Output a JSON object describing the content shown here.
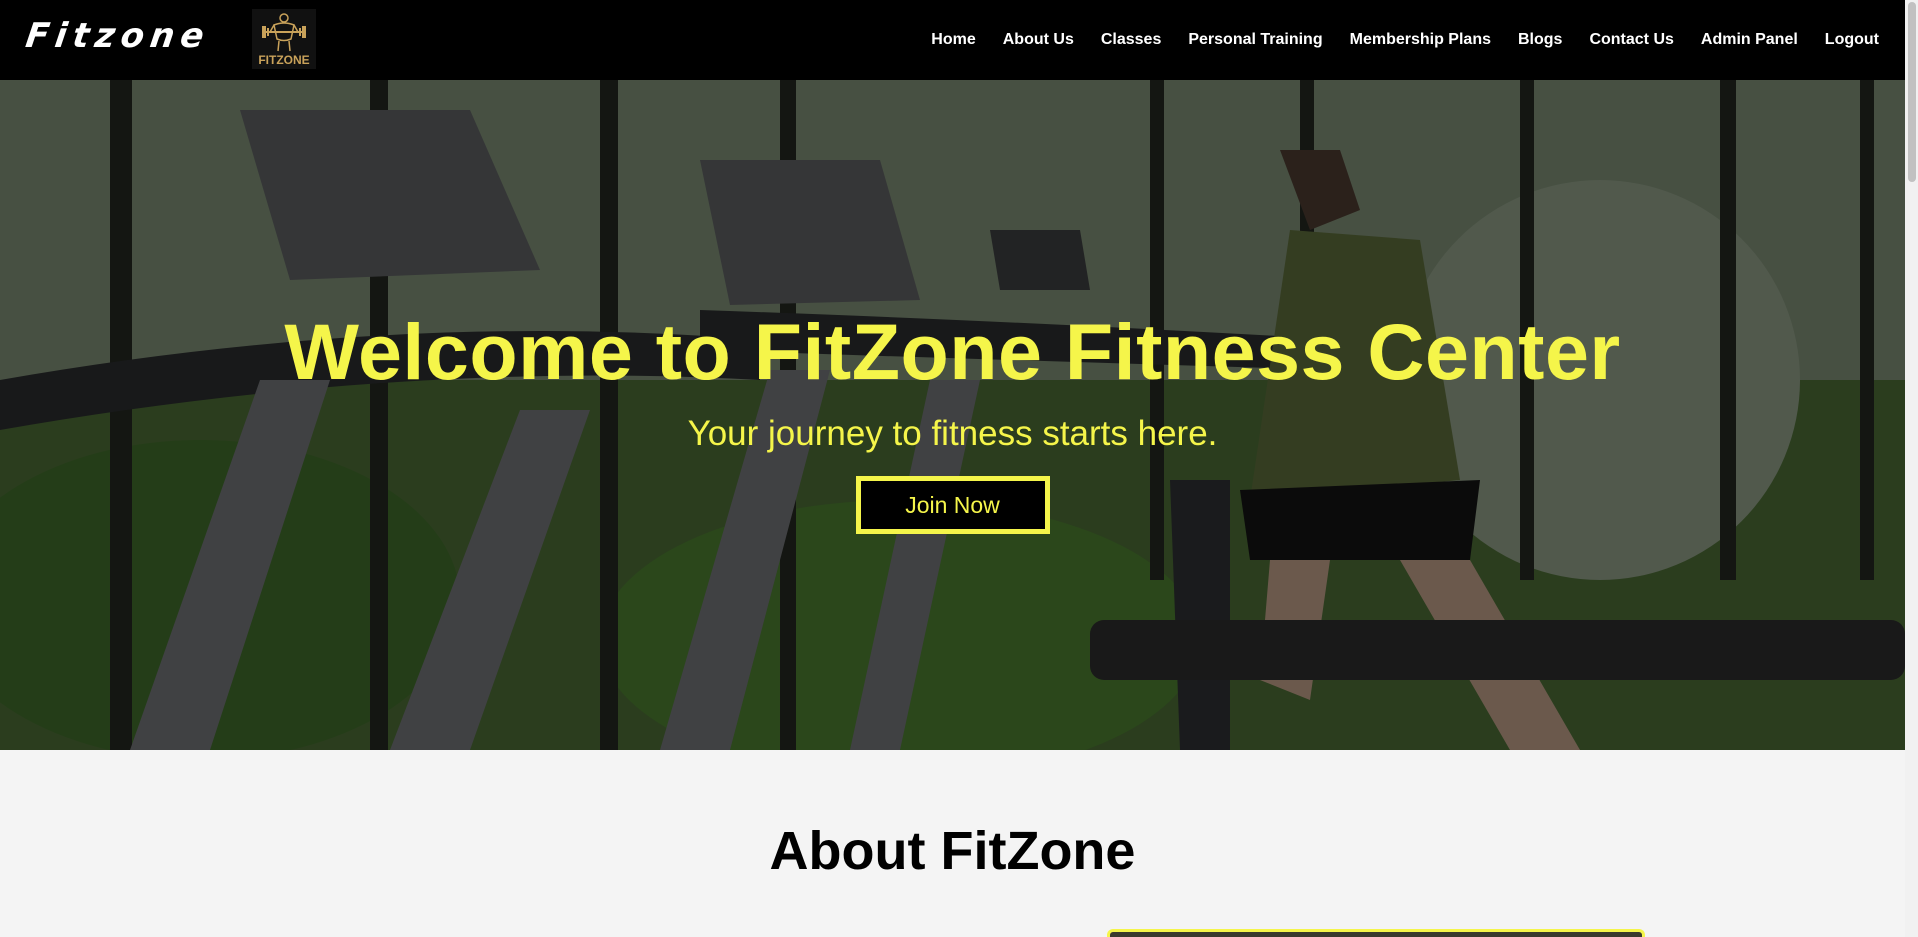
{
  "header": {
    "brand": "Fitzone",
    "logo_text": "FITZONE",
    "nav": [
      "Home",
      "About Us",
      "Classes",
      "Personal Training",
      "Membership Plans",
      "Blogs",
      "Contact Us",
      "Admin Panel",
      "Logout"
    ]
  },
  "hero": {
    "title": "Welcome to FitZone Fitness Center",
    "subtitle": "Your journey to fitness starts here.",
    "cta_label": "Join Now"
  },
  "about": {
    "title": "About FitZone"
  },
  "colors": {
    "accent": "#f5f54a",
    "navbar": "#000000",
    "page_bg": "#f4f4f4",
    "logo_gold": "#c9a25a"
  },
  "icons": {
    "logo": "bodybuilder-barbell-icon"
  }
}
